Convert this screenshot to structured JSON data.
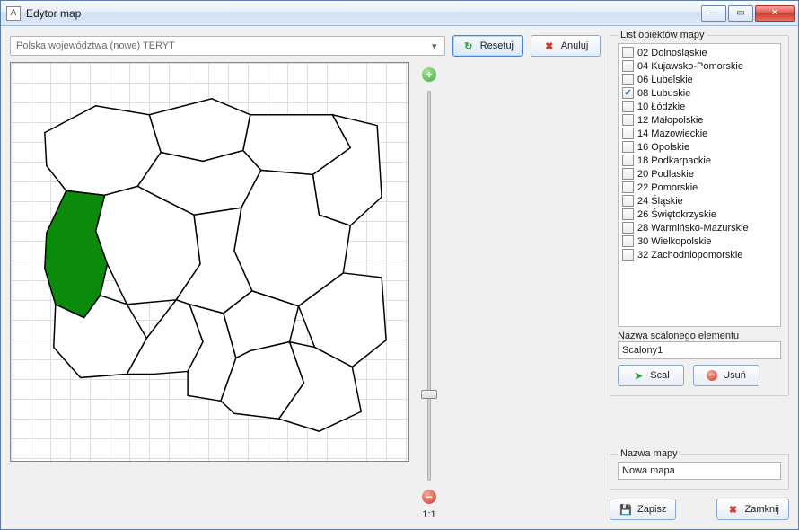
{
  "window": {
    "title": "Edytor map",
    "appicon_glyph": "A"
  },
  "toolbar": {
    "map_source": "Polska województwa (nowe) TERYT",
    "reset_label": "Resetuj",
    "cancel_label": "Anuluj"
  },
  "zoom": {
    "ratio_label": "1:1"
  },
  "objects_panel": {
    "legend": "List obiektów mapy",
    "items": [
      {
        "label": "02 Dolnośląskie",
        "checked": false
      },
      {
        "label": "04 Kujawsko-Pomorskie",
        "checked": false
      },
      {
        "label": "06 Lubelskie",
        "checked": false
      },
      {
        "label": "08 Lubuskie",
        "checked": true
      },
      {
        "label": "10 Łódzkie",
        "checked": false
      },
      {
        "label": "12 Małopolskie",
        "checked": false
      },
      {
        "label": "14 Mazowieckie",
        "checked": false
      },
      {
        "label": "16 Opolskie",
        "checked": false
      },
      {
        "label": "18 Podkarpackie",
        "checked": false
      },
      {
        "label": "20 Podlaskie",
        "checked": false
      },
      {
        "label": "22 Pomorskie",
        "checked": false
      },
      {
        "label": "24 Śląskie",
        "checked": false
      },
      {
        "label": "26 Świętokrzyskie",
        "checked": false
      },
      {
        "label": "28 Warmińsko-Mazurskie",
        "checked": false
      },
      {
        "label": "30 Wielkopolskie",
        "checked": false
      },
      {
        "label": "32 Zachodniopomorskie",
        "checked": false
      }
    ],
    "merge_name_label": "Nazwa scalonego elementu",
    "merge_name_value": "Scalony1",
    "merge_button": "Scal",
    "delete_button": "Usuń"
  },
  "map_name": {
    "label": "Nazwa mapy",
    "value": "Nowa mapa"
  },
  "footer": {
    "save_label": "Zapisz",
    "close_label": "Zamknij"
  },
  "selected_region": "08 Lubuskie"
}
